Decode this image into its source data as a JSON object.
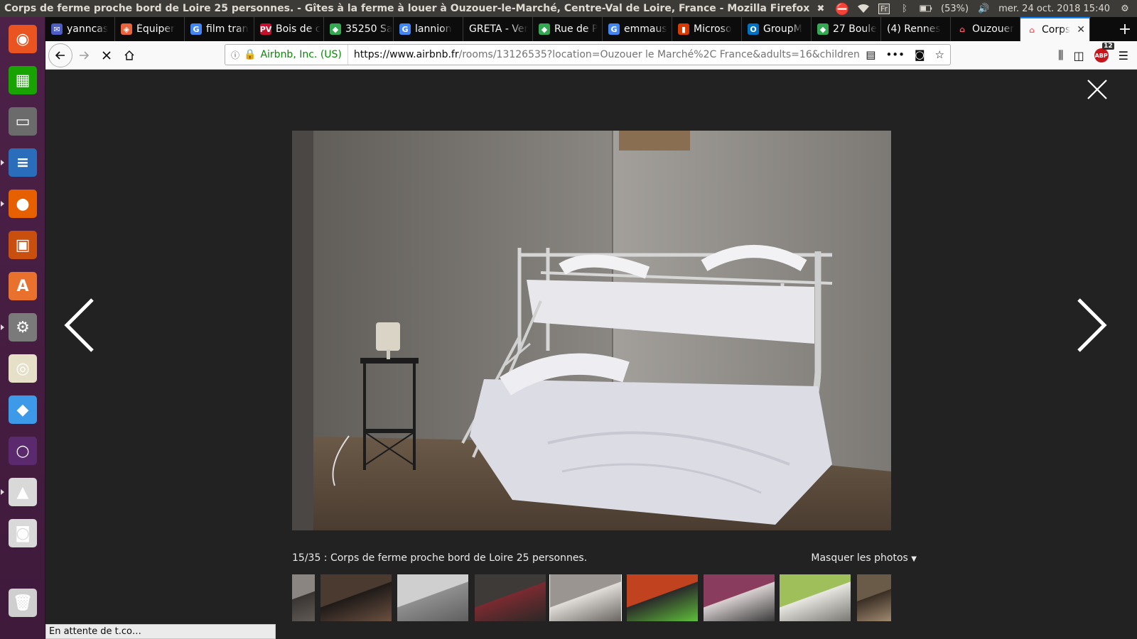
{
  "window": {
    "title": "Corps de ferme proche bord de Loire 25 personnes. - Gîtes à la ferme à louer à Ouzouer-le-Marché, Centre-Val de Loire, France - Mozilla Firefox"
  },
  "panel": {
    "keyboard": "Fr",
    "battery": "(53%)",
    "clock": "mer. 24 oct. 2018 15:40"
  },
  "launcher": [
    {
      "name": "ubuntu-dash-icon",
      "color": "#e95420",
      "glyph": "◉"
    },
    {
      "name": "calc-spreadsheet-icon",
      "color": "#18a303",
      "glyph": "▦"
    },
    {
      "name": "files-icon",
      "color": "#6b6b6b",
      "glyph": "▭"
    },
    {
      "name": "writer-document-icon",
      "color": "#2a6ebb",
      "glyph": "≡"
    },
    {
      "name": "firefox-icon",
      "color": "#e66000",
      "glyph": "●"
    },
    {
      "name": "impress-presentation-icon",
      "color": "#c94f0f",
      "glyph": "▣"
    },
    {
      "name": "software-center-icon",
      "color": "#e8712d",
      "glyph": "A"
    },
    {
      "name": "system-settings-icon",
      "color": "#7a7a7a",
      "glyph": "⚙"
    },
    {
      "name": "rhythmbox-speaker-icon",
      "color": "#e6e0c8",
      "glyph": "◎"
    },
    {
      "name": "dropbox-icon",
      "color": "#3d9ae8",
      "glyph": "◆"
    },
    {
      "name": "unity-tweak-icon",
      "color": "#5b2a6e",
      "glyph": "○"
    },
    {
      "name": "lock-screen-icon",
      "color": "#d9d9d9",
      "glyph": "▲"
    },
    {
      "name": "camera-screenshot-icon",
      "color": "#d9d9d9",
      "glyph": "◙"
    },
    {
      "name": "trash-icon",
      "color": "#cfcfcf",
      "glyph": "🗑"
    }
  ],
  "tabs": [
    {
      "label": "yanncas",
      "favColor": "#4b5cc4",
      "fav": "✉"
    },
    {
      "label": "Équiper",
      "favColor": "#e8643d",
      "fav": "◈"
    },
    {
      "label": "film tran",
      "favColor": "#4285f4",
      "fav": "G"
    },
    {
      "label": "Bois de c",
      "favColor": "#c8102e",
      "fav": "PV"
    },
    {
      "label": "35250 Sa",
      "favColor": "#34a853",
      "fav": "◆"
    },
    {
      "label": "lannion",
      "favColor": "#4285f4",
      "fav": "G"
    },
    {
      "label": "GRETA - Ver",
      "favColor": "",
      "fav": ""
    },
    {
      "label": "Rue de P",
      "favColor": "#34a853",
      "fav": "◆"
    },
    {
      "label": "emmaus",
      "favColor": "#4285f4",
      "fav": "G"
    },
    {
      "label": "Microso",
      "favColor": "#d83b01",
      "fav": "▮"
    },
    {
      "label": "GroupM",
      "favColor": "#0072c6",
      "fav": "O"
    },
    {
      "label": "27 Boule",
      "favColor": "#34a853",
      "fav": "◆"
    },
    {
      "label": "(4) Rennes",
      "favColor": "",
      "fav": ""
    },
    {
      "label": "Ouzouer",
      "favColor": "",
      "fav": "⌂"
    },
    {
      "label": "Corps",
      "favColor": "",
      "fav": "⌂",
      "active": true
    }
  ],
  "nav": {
    "identity": "Airbnb, Inc. (US)",
    "url_host": "https://www.airbnb.fr",
    "url_path": "/rooms/13126535?location=Ouzouer le Marché%2C France&adults=16&children",
    "abp_count": "12",
    "abp_label": "ABP"
  },
  "viewer": {
    "caption": "15/35 : Corps de ferme proche bord de Loire 25 personnes.",
    "hide_photos": "Masquer les photos",
    "thumbnails": [
      {
        "palette": [
          "#8a8580",
          "#3a3532",
          "#5f5a55"
        ]
      },
      {
        "palette": [
          "#4a3a30",
          "#1f1a18",
          "#6a5040"
        ]
      },
      {
        "palette": [
          "#cfcfcf",
          "#8f8f8f",
          "#5f5f5f"
        ]
      },
      {
        "palette": [
          "#3d3a38",
          "#7a2a30",
          "#2a2826"
        ]
      },
      {
        "palette": [
          "#9a9590",
          "#e0ddd8",
          "#6a6560"
        ]
      },
      {
        "palette": [
          "#c0421f",
          "#2a2a2a",
          "#5fbf3a"
        ]
      },
      {
        "palette": [
          "#8a3c5e",
          "#d8d0d0",
          "#3a3a3a"
        ]
      },
      {
        "palette": [
          "#9fbf5a",
          "#e8e6e0",
          "#7a7872"
        ]
      },
      {
        "palette": [
          "#6a5a48",
          "#3a2e24",
          "#a08a70"
        ]
      }
    ]
  },
  "status": {
    "text": "En attente de t.co…"
  }
}
